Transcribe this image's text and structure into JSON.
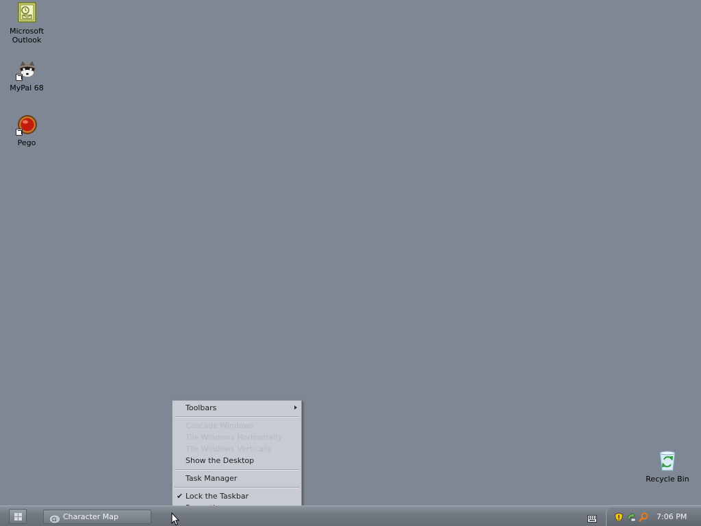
{
  "desktop": {
    "icons": [
      {
        "label": "Microsoft\nOutlook",
        "icon": "outlook-icon"
      },
      {
        "label": "MyPal 68",
        "icon": "raccoon-icon"
      },
      {
        "label": "Pego",
        "icon": "pego-icon"
      },
      {
        "label": "Recycle Bin",
        "icon": "recycle-bin-icon"
      }
    ]
  },
  "context_menu": {
    "items": [
      {
        "label": "Toolbars",
        "enabled": true,
        "submenu": true
      },
      {
        "label": "Cascade Windows",
        "enabled": false
      },
      {
        "label": "Tile Windows Horizontally",
        "enabled": false
      },
      {
        "label": "Tile Windows Vertically",
        "enabled": false
      },
      {
        "label": "Show the Desktop",
        "enabled": true
      },
      {
        "label": "Task Manager",
        "enabled": true
      },
      {
        "label": "Lock the Taskbar",
        "enabled": true,
        "checked": true
      },
      {
        "label": "Properties",
        "enabled": true
      }
    ],
    "check_glyph": "✔"
  },
  "taskbar": {
    "start_icon": "grid-icon",
    "task_buttons": [
      {
        "label": "Character Map",
        "icon": "character-map-icon"
      }
    ],
    "quick_icon": "keyboard-icon",
    "tray": {
      "icons": [
        "security-shield-icon",
        "network-icon",
        "search-icon"
      ],
      "clock": "7:06 PM"
    }
  },
  "colors": {
    "desktop_background": "#7e8793",
    "menu_background": "#c8cbd1",
    "disabled_text": "#b5b9bf"
  }
}
